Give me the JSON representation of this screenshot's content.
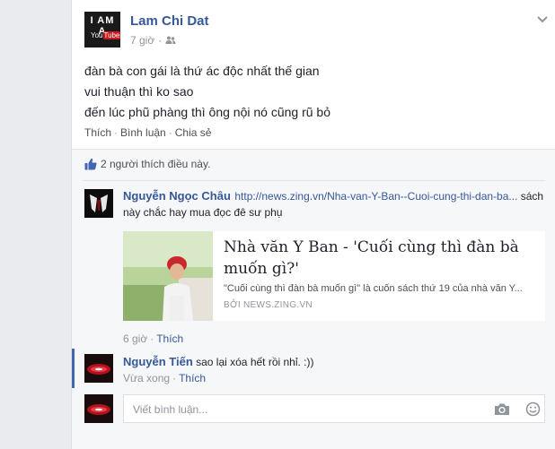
{
  "post": {
    "author": "Lam Chi Dat",
    "time": "7 giờ",
    "avatar": {
      "line1": "I AM A",
      "brand": "You",
      "brand_box": "Tube"
    },
    "lines": [
      "đàn bà con gái là thứ ác độc nhất thế gian",
      "vui thuận thì ko sao",
      "đến lúc phũ phàng thì ông nội nó cũng rũ bỏ"
    ],
    "actions": {
      "like": "Thích",
      "comment": "Bình luận",
      "share": "Chia sẻ",
      "separator": "·"
    }
  },
  "likes": {
    "text": "2 người thích điều này."
  },
  "comments": [
    {
      "author": "Nguyễn Ngọc Châu",
      "link": "http://news.zing.vn/Nha-van-Y-Ban--Cuoi-cung-thi-dan-ba...",
      "text_tail": " sách",
      "text_line2": "này chắc hay mua đọc đê sư phụ",
      "time": "6 giờ",
      "like": "Thích",
      "share": {
        "title": "Nhà văn Y Ban - 'Cuối cùng thì đàn bà muốn gì?'",
        "description": "\"Cuối cùng thì đàn bà muốn gì\" là cuốn sách thứ 19 của nhà văn Y...",
        "domain": "BỞI NEWS.ZING.VN"
      }
    },
    {
      "author": "Nguyễn Tiến",
      "text": " sao lại xóa hết rồi nhỉ. :))",
      "time": "Vừa xong",
      "like": "Thích"
    }
  ],
  "composer": {
    "placeholder": "Viết bình luận..."
  },
  "colors": {
    "link": "#365899",
    "accent_bar": "#4267b2",
    "like_icon": "#4267b2"
  }
}
